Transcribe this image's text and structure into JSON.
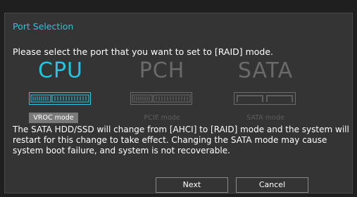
{
  "dialog": {
    "title": "Port Selection",
    "prompt": "Please select the port that you want to set to [RAID] mode.",
    "options": [
      {
        "name": "CPU",
        "mode": "VROC mode",
        "selected": true
      },
      {
        "name": "PCH",
        "mode": "PCIE mode",
        "selected": false
      },
      {
        "name": "SATA",
        "mode": "SATA mode",
        "selected": false
      }
    ],
    "warning": "The SATA HDD/SSD will change from [AHCI] to [RAID] mode and the system will restart for this change to take effect. Changing the SATA mode may cause system boot failure, and system is not recoverable.",
    "buttons": {
      "next": "Next",
      "cancel": "Cancel"
    }
  },
  "colors": {
    "accent": "#23c4e0",
    "disabled": "#6a6a6a",
    "background": "#343434"
  }
}
